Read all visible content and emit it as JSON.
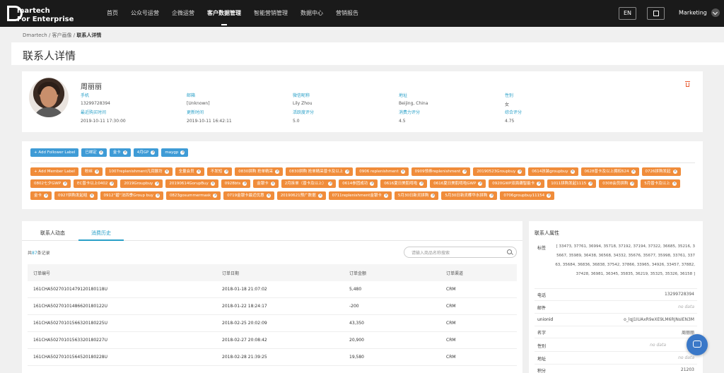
{
  "nav": {
    "brand_line1": "martech",
    "brand_line2": "For Enterprise",
    "items": [
      "首页",
      "公众号运营",
      "企微运营",
      "客户数据管理",
      "智能营销管理",
      "数据中心",
      "营销报告"
    ],
    "active_index": 3,
    "lang_button": "EN",
    "user": "Marketing"
  },
  "breadcrumb": {
    "parts": [
      "Dmartech",
      "客户画像"
    ],
    "current": "联系人详情"
  },
  "page_title": "联系人详情",
  "profile": {
    "name": "周丽丽",
    "fields": [
      {
        "label": "手机",
        "value": "13299728394"
      },
      {
        "label": "邮箱",
        "value": "[Unknown]"
      },
      {
        "label": "微信昵称",
        "value": "Lily Zhou"
      },
      {
        "label": "地址",
        "value": "Beijing, China"
      },
      {
        "label": "性别",
        "value": "女"
      },
      {
        "label": "最近购买时间",
        "value": "2019-10-11 17:30:00"
      },
      {
        "label": "更新时间",
        "value": "2019-10-11 16:42:11"
      },
      {
        "label": "活跃度评分",
        "value": "5.0"
      },
      {
        "label": "消费力评分",
        "value": "4.5"
      },
      {
        "label": "综合评分",
        "value": "4.75"
      }
    ]
  },
  "follower_labels": {
    "add_button": "+ Add Follower Label",
    "tags": [
      "已绑定",
      "金卡",
      "4月GP",
      "maygp"
    ]
  },
  "member_labels": {
    "add_button": "+ Add Member Label",
    "tags": [
      "粉丝",
      "1007replenishment凡润展坊",
      "全量会员",
      "不发短",
      "0830拼购 抢单精采",
      "0830拼购 抢单精采普卡及以上",
      "0906 replenishment",
      "0909领券replenishment",
      "20190523Groupbuy",
      "0614孩装groupbuy",
      "0628普卡及以上拥权624",
      "0726拼购发起",
      "0802七夕GWP",
      "EC普卡以上0402",
      "2019Groupbuy",
      "20190614GorupBuy",
      "0928bts",
      "金银卡",
      "2月拆单（普卡及以上）",
      "0614参团成功",
      "0616夏日美肌啃啦",
      "0616夏日美肌啃啦GWP",
      "0920GWP双面聋智能卡",
      "1011拼购发起1115",
      "0308会员拼购",
      "5月普卡及以上",
      "金卡",
      "0927拼购发起组",
      "0912“碧”法四季Group buy",
      "0823gosummermask",
      "0719金银卡最近优惠",
      "20190621预广数据",
      "0711replenishment金银卡",
      "5月30日新灵拼购",
      "5月30日新灵椰华水拼购",
      "0706groupbuy11154"
    ]
  },
  "orders": {
    "tabs": [
      "联系人动态",
      "消费历史"
    ],
    "active_tab": 1,
    "count_prefix": "共",
    "count_num": "87",
    "count_suffix": "条记录",
    "search_placeholder": "请输入商品名称搜索",
    "columns": [
      "订单编号",
      "订单日期",
      "订单金额",
      "订单渠道"
    ],
    "rows": [
      [
        "161CHA50270101479120180118U",
        "2018-01-18 21:07:02",
        "5,480",
        "CRM"
      ],
      [
        "161CHA50270101486620180122U",
        "2018-01-22 18:24:17",
        "-200",
        "CRM"
      ],
      [
        "161CHA50270101566320180225U",
        "2018-02-25 20:02:09",
        "43,350",
        "CRM"
      ],
      [
        "161CHA50270101563320180227U",
        "2018-02-27 20:08:42",
        "20,900",
        "CRM"
      ],
      [
        "161CHA50270101564520180228U",
        "2018-02-28 21:39:25",
        "19,580",
        "CRM"
      ]
    ]
  },
  "attributes": {
    "title": "联系人属性",
    "tag_label": "标签",
    "tag_lines": [
      "[ 33473, 37761, 36994, 35718, 37192, 37194, 37322, 36685, 35216, 3",
      "5667, 35989, 36438, 36568, 34332, 35676, 35677, 35998, 33761, 337",
      "63, 35684, 36836, 36838, 37542, 37866, 33965, 34926, 33457, 37882,",
      "37428, 36981, 36345, 35835, 36219, 35325, 35326, 36158 ]"
    ],
    "rows": [
      {
        "label": "电话",
        "value": "13299728394",
        "nodata": false
      },
      {
        "label": "邮件",
        "value": "no data",
        "nodata": true
      },
      {
        "label": "unionid",
        "value": "o_lqJ1IUAxR9eXE9LM6RJNsIEN3M",
        "nodata": false
      },
      {
        "label": "名字",
        "value": "周丽丽",
        "nodata": false
      },
      {
        "label": "性别",
        "value": "no data",
        "nodata": true
      },
      {
        "label": "地址",
        "value": "no data",
        "nodata": true
      },
      {
        "label": "积分",
        "value": "21203",
        "nodata": false
      }
    ]
  }
}
